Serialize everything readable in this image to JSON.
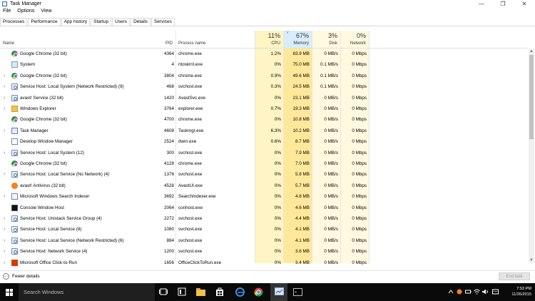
{
  "window": {
    "title": "Task Manager",
    "controls": [
      "—",
      "❐",
      "✕"
    ]
  },
  "menu": [
    "File",
    "Options",
    "View"
  ],
  "tabs": [
    "Processes",
    "Performance",
    "App history",
    "Startup",
    "Users",
    "Details",
    "Services"
  ],
  "header": {
    "name": "Name",
    "pid": "PID",
    "process_name": "Process name",
    "cpu_pct": "11%",
    "cpu": "CPU",
    "memory_pct": "67%",
    "memory": "Memory",
    "disk_pct": "3%",
    "disk": "Disk",
    "network_pct": "0%",
    "network": "Network",
    "sort_indicator": "˅"
  },
  "rows": [
    {
      "expand": false,
      "icon": "chrome-icon",
      "name": "Google Chrome (32 bit)",
      "pid": "4364",
      "proc": "chrome.exe",
      "cpu": "1.2%",
      "mem": "83.9 MB",
      "disk": "0 MB/s",
      "net": "0 Mbps"
    },
    {
      "expand": false,
      "icon": "system-icon",
      "name": "System",
      "pid": "4",
      "proc": "ntoskrnl.exe",
      "cpu": "0%",
      "mem": "75.0 MB",
      "disk": "0.1 MB/s",
      "net": "0 Mbps"
    },
    {
      "expand": true,
      "icon": "chrome-icon",
      "name": "Google Chrome (32 bit)",
      "pid": "3804",
      "proc": "chrome.exe",
      "cpu": "0.9%",
      "mem": "49.6 MB",
      "disk": "0.1 MB/s",
      "net": "0 Mbps"
    },
    {
      "expand": true,
      "icon": "service-host-icon",
      "name": "Service Host: Local System (Network Restricted) (9)",
      "pid": "468",
      "proc": "svchost.exe",
      "cpu": "0.3%",
      "mem": "24.5 MB",
      "disk": "0.1 MB/s",
      "net": "0 Mbps"
    },
    {
      "expand": true,
      "icon": "service-host-icon",
      "name": "avast! Service (32 bit)",
      "pid": "1420",
      "proc": "AvastSvc.exe",
      "cpu": "0%",
      "mem": "23.1 MB",
      "disk": "0 MB/s",
      "net": "0 Mbps"
    },
    {
      "expand": true,
      "icon": "explorer-icon",
      "name": "Windows Explorer",
      "pid": "3764",
      "proc": "explorer.exe",
      "cpu": "0.7%",
      "mem": "19.3 MB",
      "disk": "0 MB/s",
      "net": "0 Mbps"
    },
    {
      "expand": false,
      "icon": "chrome-icon",
      "name": "Google Chrome (32 bit)",
      "pid": "4700",
      "proc": "chrome.exe",
      "cpu": "0%",
      "mem": "10.8 MB",
      "disk": "0 MB/s",
      "net": "0 Mbps"
    },
    {
      "expand": true,
      "icon": "task-manager-icon",
      "name": "Task Manager",
      "pid": "4608",
      "proc": "Taskmgr.exe",
      "cpu": "6.3%",
      "mem": "10.2 MB",
      "disk": "0 MB/s",
      "net": "0 Mbps"
    },
    {
      "expand": false,
      "icon": "desktop-window-manager-icon",
      "name": "Desktop Window Manager",
      "pid": "2524",
      "proc": "dwm.exe",
      "cpu": "0.6%",
      "mem": "8.7 MB",
      "disk": "0 MB/s",
      "net": "0 Mbps"
    },
    {
      "expand": true,
      "icon": "service-host-icon",
      "name": "Service Host: Local System (12)",
      "pid": "300",
      "proc": "svchost.exe",
      "cpu": "0%",
      "mem": "7.9 MB",
      "disk": "0 MB/s",
      "net": "0 Mbps"
    },
    {
      "expand": false,
      "icon": "chrome-icon",
      "name": "Google Chrome (32 bit)",
      "pid": "4128",
      "proc": "chrome.exe",
      "cpu": "0%",
      "mem": "7.0 MB",
      "disk": "0 MB/s",
      "net": "0 Mbps"
    },
    {
      "expand": true,
      "icon": "service-host-icon",
      "name": "Service Host: Local Service (No Network) (4)",
      "pid": "1376",
      "proc": "svchost.exe",
      "cpu": "0%",
      "mem": "5.8 MB",
      "disk": "0 MB/s",
      "net": "0 Mbps"
    },
    {
      "expand": false,
      "icon": "avast-icon",
      "name": "avast! Antivirus (32 bit)",
      "pid": "4528",
      "proc": "AvastUI.exe",
      "cpu": "0%",
      "mem": "5.7 MB",
      "disk": "0 MB/s",
      "net": "0 Mbps"
    },
    {
      "expand": true,
      "icon": "search-indexer-icon",
      "name": "Microsoft Windows Search Indexer",
      "pid": "3692",
      "proc": "SearchIndexer.exe",
      "cpu": "0%",
      "mem": "4.8 MB",
      "disk": "0 MB/s",
      "net": "0 Mbps"
    },
    {
      "expand": false,
      "icon": "console-icon",
      "name": "Console Window Host",
      "pid": "2064",
      "proc": "conhost.exe",
      "cpu": "0%",
      "mem": "4.6 MB",
      "disk": "0 MB/s",
      "net": "0 Mbps"
    },
    {
      "expand": true,
      "icon": "service-host-icon",
      "name": "Service Host: Unistack Service Group (4)",
      "pid": "2272",
      "proc": "svchost.exe",
      "cpu": "0%",
      "mem": "4.4 MB",
      "disk": "0 MB/s",
      "net": "0 Mbps"
    },
    {
      "expand": true,
      "icon": "service-host-icon",
      "name": "Service Host: Local Service (8)",
      "pid": "1080",
      "proc": "svchost.exe",
      "cpu": "0%",
      "mem": "4.1 MB",
      "disk": "0 MB/s",
      "net": "0 Mbps"
    },
    {
      "expand": true,
      "icon": "service-host-icon",
      "name": "Service Host: Local Service (Network Restricted) (6)",
      "pid": "884",
      "proc": "svchost.exe",
      "cpu": "0%",
      "mem": "4.1 MB",
      "disk": "0 MB/s",
      "net": "0 Mbps"
    },
    {
      "expand": true,
      "icon": "service-host-icon",
      "name": "Service Host: Network Service (4)",
      "pid": "1200",
      "proc": "svchost.exe",
      "cpu": "0%",
      "mem": "3.6 MB",
      "disk": "0 MB/s",
      "net": "0 Mbps"
    },
    {
      "expand": true,
      "icon": "office-icon",
      "name": "Microsoft Office Click-to-Run",
      "pid": "1656",
      "proc": "OfficeClickToRun.exe",
      "cpu": "0%",
      "mem": "3.4 MB",
      "disk": "0 MB/s",
      "net": "0 Mbps"
    }
  ],
  "footer": {
    "fewer_details": "Fewer details",
    "end_task": "End task"
  },
  "taskbar": {
    "search_placeholder": "Search Windows",
    "time": "7:53 PM",
    "date": "11/26/2015"
  },
  "colors": {
    "cpu_col": "#fff4c4",
    "mem_col": "#ffe89a",
    "mem_header": "#d9ecfa",
    "light_col": "#fff9df"
  }
}
